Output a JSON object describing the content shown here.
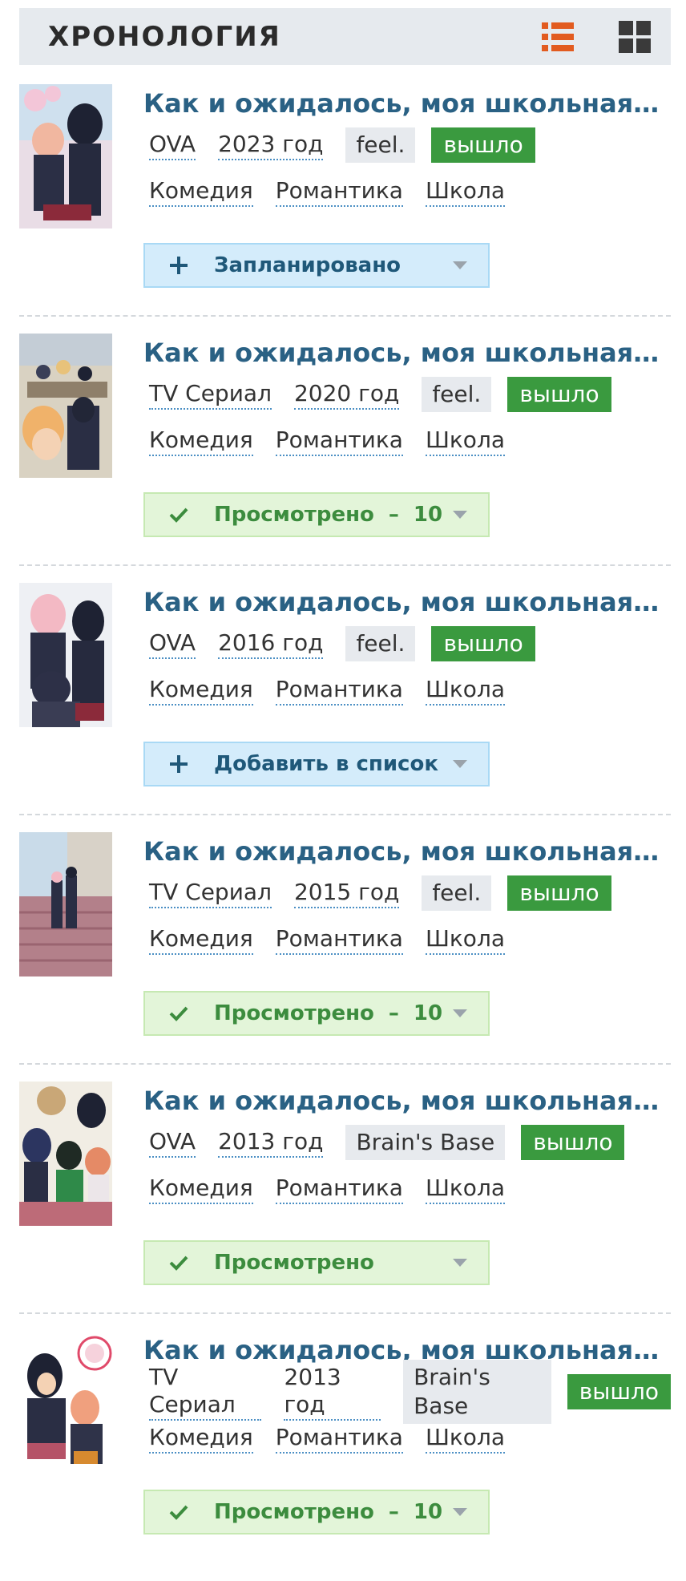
{
  "header": {
    "title": "ХРОНОЛОГИЯ",
    "list_icon": "list-view-icon",
    "grid_icon": "grid-view-icon",
    "accent_color": "#e25b1f",
    "grid_color": "#3a3a3a"
  },
  "entries": [
    {
      "title": "Как и ожидалось, моя школьная романтическая жизнь не удалась",
      "type": "OVA",
      "year": "2023 год",
      "studio": "feel.",
      "status": "вышло",
      "genres": [
        "Комедия",
        "Романтика",
        "Школа"
      ],
      "action": {
        "style": "planned",
        "icon": "plus-icon",
        "label": "Запланировано",
        "sep": "",
        "count": ""
      }
    },
    {
      "title": "Как и ожидалось, моя школьная романтическая жизнь не удалась",
      "type": "TV Сериал",
      "year": "2020 год",
      "studio": "feel.",
      "status": "вышло",
      "genres": [
        "Комедия",
        "Романтика",
        "Школа"
      ],
      "action": {
        "style": "watched",
        "icon": "check-icon",
        "label": "Просмотрено",
        "sep": "–",
        "count": "10"
      }
    },
    {
      "title": "Как и ожидалось, моя школьная романтическая жизнь не удалась",
      "type": "OVA",
      "year": "2016 год",
      "studio": "feel.",
      "status": "вышло",
      "genres": [
        "Комедия",
        "Романтика",
        "Школа"
      ],
      "action": {
        "style": "planned",
        "icon": "plus-icon",
        "label": "Добавить в список",
        "sep": "",
        "count": ""
      }
    },
    {
      "title": "Как и ожидалось, моя школьная романтическая жизнь не удалась",
      "type": "TV Сериал",
      "year": "2015 год",
      "studio": "feel.",
      "status": "вышло",
      "genres": [
        "Комедия",
        "Романтика",
        "Школа"
      ],
      "action": {
        "style": "watched",
        "icon": "check-icon",
        "label": "Просмотрено",
        "sep": "–",
        "count": "10"
      }
    },
    {
      "title": "Как и ожидалось, моя школьная романтическая жизнь не удалась",
      "type": "OVA",
      "year": "2013 год",
      "studio": "Brain's Base",
      "status": "вышло",
      "genres": [
        "Комедия",
        "Романтика",
        "Школа"
      ],
      "action": {
        "style": "watched",
        "icon": "check-icon",
        "label": "Просмотрено",
        "sep": "",
        "count": ""
      }
    },
    {
      "title": "Как и ожидалось, моя школьная романтическая жизнь не удалась",
      "type": "TV Сериал",
      "year": "2013 год",
      "studio": "Brain's Base",
      "status": "вышло",
      "genres": [
        "Комедия",
        "Романтика",
        "Школа"
      ],
      "action": {
        "style": "watched",
        "icon": "check-icon",
        "label": "Просмотрено",
        "sep": "–",
        "count": "10"
      }
    }
  ]
}
